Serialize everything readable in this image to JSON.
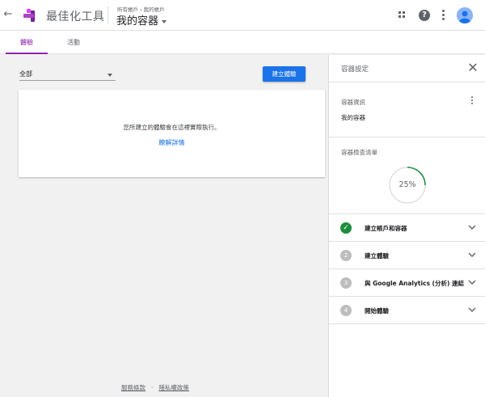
{
  "header": {
    "product_name": "最佳化工具",
    "breadcrumb": [
      "所有帳戶",
      "我的帳戶"
    ],
    "breadcrumb_separator": "›",
    "container_name": "我的容器",
    "help_glyph": "?",
    "back_glyph": "←",
    "icons": [
      "back-arrow-icon",
      "optimize-logo-icon",
      "apps-grid-icon",
      "help-icon",
      "more-vert-icon",
      "account-avatar-icon"
    ]
  },
  "tabs": [
    {
      "label": "體驗",
      "active": true
    },
    {
      "label": "活動",
      "active": false
    }
  ],
  "main": {
    "filter_value": "全部",
    "create_button": "建立體驗",
    "empty_text": "您所建立的體驗會在這裡實際執行。",
    "learn_more": "瞭解詳情"
  },
  "footer": {
    "terms": "服務條款",
    "separator": "·",
    "privacy": "隱私權政策"
  },
  "panel": {
    "title": "容器設定",
    "close_glyph": "✕",
    "info_label": "容器資訊",
    "info_value": "我的容器",
    "checklist_label": "容器檢查清單",
    "progress_value": 25,
    "progress_text": "25%",
    "steps": [
      {
        "number": "✓",
        "label": "建立帳戶和容器",
        "done": true
      },
      {
        "number": "2",
        "label": "建立體驗",
        "done": false
      },
      {
        "number": "3",
        "label": "與 Google Analytics (分析) 連結",
        "done": false
      },
      {
        "number": "4",
        "label": "開始體驗",
        "done": false
      }
    ]
  },
  "colors": {
    "accent_purple": "#8e24aa",
    "primary_blue": "#1a73e8",
    "success_green": "#1e8e3e",
    "pending_grey": "#bdbdbd"
  }
}
